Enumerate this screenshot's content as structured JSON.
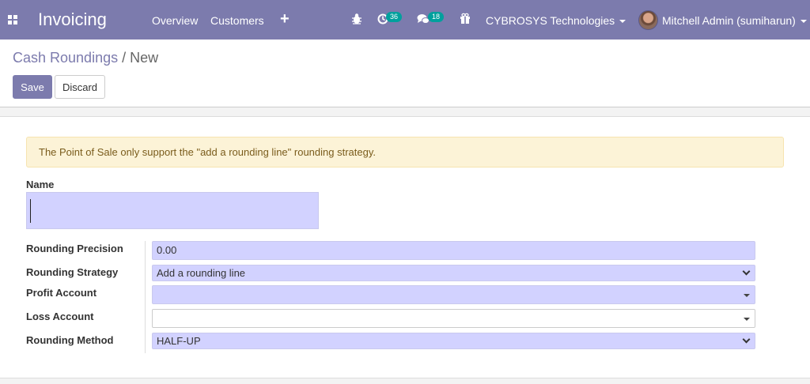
{
  "navbar": {
    "app_name": "Invoicing",
    "menu": [
      "Overview",
      "Customers"
    ],
    "plus_label": "+",
    "activity_badge": "36",
    "messages_badge": "18",
    "company": "CYBROSYS Technologies",
    "user": "Mitchell Admin (sumiharun)",
    "colors": {
      "navbar": "#7c7bad",
      "badge": "#00a09d"
    }
  },
  "breadcrumb": {
    "parent": "Cash Roundings",
    "separator": "/",
    "current": "New"
  },
  "buttons": {
    "save": "Save",
    "discard": "Discard"
  },
  "alert": {
    "text": "The Point of Sale only support the \"add a rounding line\" rounding strategy."
  },
  "form": {
    "name_label": "Name",
    "name_value": "",
    "fields": [
      {
        "label": "Rounding Precision",
        "value": "0.00",
        "type": "text"
      },
      {
        "label": "Rounding Strategy",
        "value": "Add a rounding line",
        "type": "select"
      },
      {
        "label": "Profit Account",
        "value": "",
        "type": "many2one"
      },
      {
        "label": "Loss Account",
        "value": "",
        "type": "many2one"
      },
      {
        "label": "Rounding Method",
        "value": "HALF-UP",
        "type": "select"
      }
    ]
  }
}
